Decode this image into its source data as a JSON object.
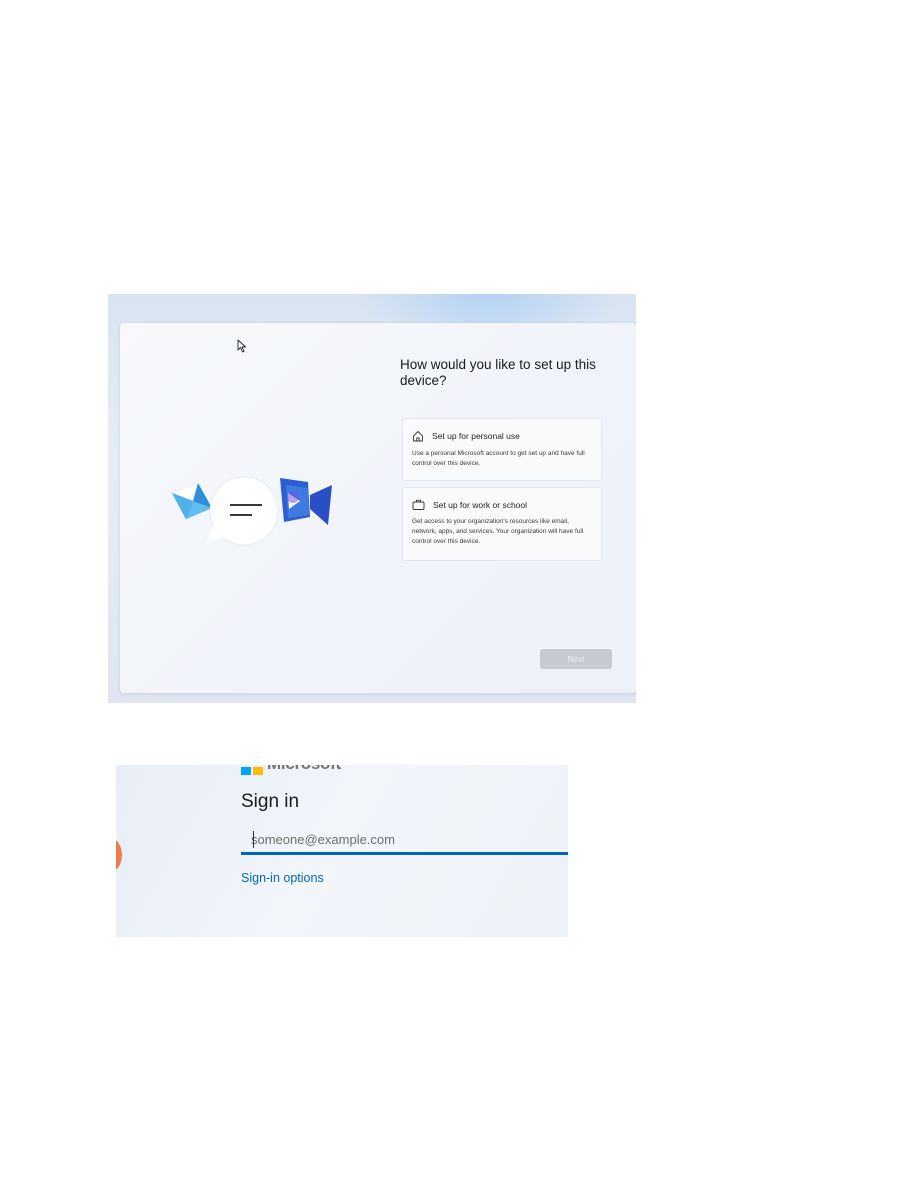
{
  "setup_screen": {
    "heading": "How would you like to set up this device?",
    "options": [
      {
        "icon": "home-icon",
        "title": "Set up for personal use",
        "description": "Use a personal Microsoft account to get set up and have full control over this device."
      },
      {
        "icon": "briefcase-icon",
        "title": "Set up for work or school",
        "description": "Get access to your organization's resources like email, network, apps, and services. Your organization will have full control over this device."
      }
    ],
    "next_label": "Next"
  },
  "signin_screen": {
    "brand": "Microsoft",
    "title": "Sign in",
    "email_placeholder": "someone@example.com",
    "options_link": "Sign-in options",
    "accent_color": "#0067b8"
  }
}
